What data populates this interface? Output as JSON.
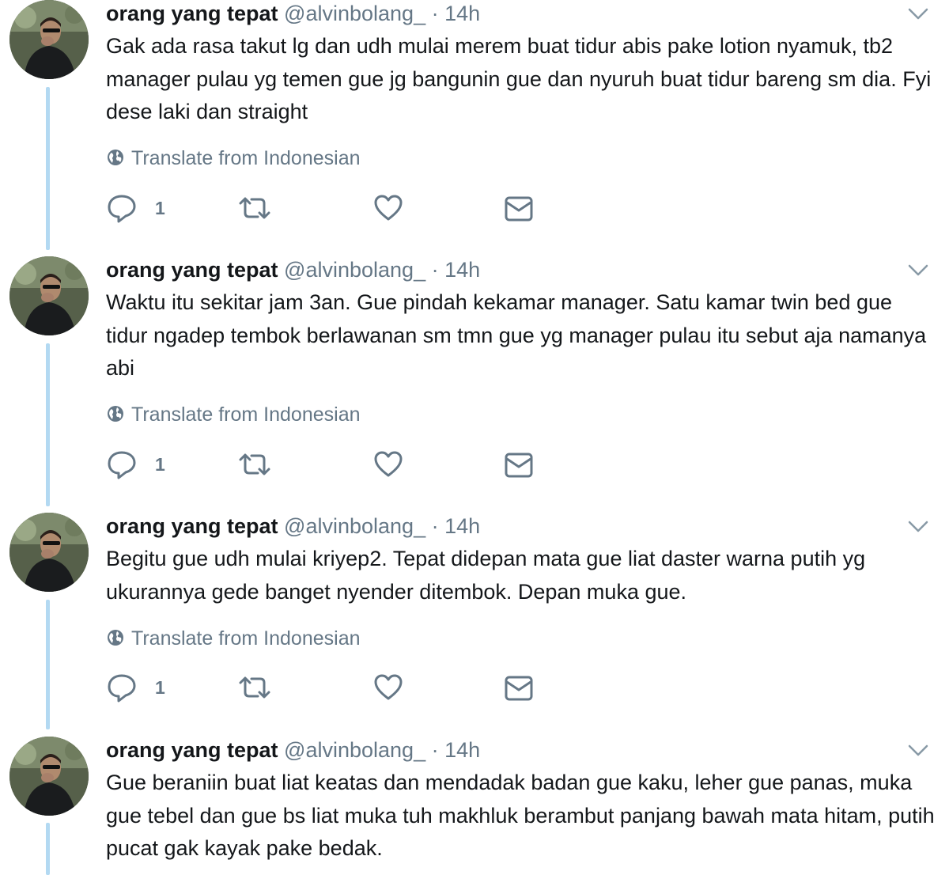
{
  "tweets": [
    {
      "name": "orang yang tepat",
      "handle": "@alvinbolang_",
      "separator": "·",
      "time": "14h",
      "text": "Gak ada rasa takut lg dan udh mulai merem buat tidur abis pake lotion nyamuk, tb2 manager pulau yg temen gue jg bangunin gue dan nyuruh buat tidur bareng sm dia. Fyi dese laki dan straight",
      "translate": "Translate from Indonesian",
      "reply_count": "1"
    },
    {
      "name": "orang yang tepat",
      "handle": "@alvinbolang_",
      "separator": "·",
      "time": "14h",
      "text": "Waktu itu sekitar jam 3an. Gue pindah kekamar manager. Satu kamar twin bed gue tidur ngadep tembok berlawanan sm tmn gue yg manager pulau itu sebut aja namanya abi",
      "translate": "Translate from Indonesian",
      "reply_count": "1"
    },
    {
      "name": "orang yang tepat",
      "handle": "@alvinbolang_",
      "separator": "·",
      "time": "14h",
      "text": "Begitu gue udh mulai kriyep2. Tepat didepan mata gue liat daster warna putih yg ukurannya gede banget nyender ditembok. Depan muka gue.",
      "translate": "Translate from Indonesian",
      "reply_count": "1"
    },
    {
      "name": "orang yang tepat",
      "handle": "@alvinbolang_",
      "separator": "·",
      "time": "14h",
      "text": "Gue beraniin buat liat keatas dan mendadak badan gue kaku, leher gue panas, muka gue tebel dan gue bs liat muka tuh makhluk berambut panjang bawah mata hitam, putih pucat gak kayak pake bedak."
    }
  ],
  "icons": {
    "reply": "reply-icon",
    "retweet": "retweet-icon",
    "like": "heart-icon",
    "dm": "envelope-icon",
    "translate": "globe-icon",
    "menu": "chevron-down-icon"
  },
  "colors": {
    "text": "#14171a",
    "secondary": "#657786",
    "thread_line": "#b3d9f2"
  }
}
